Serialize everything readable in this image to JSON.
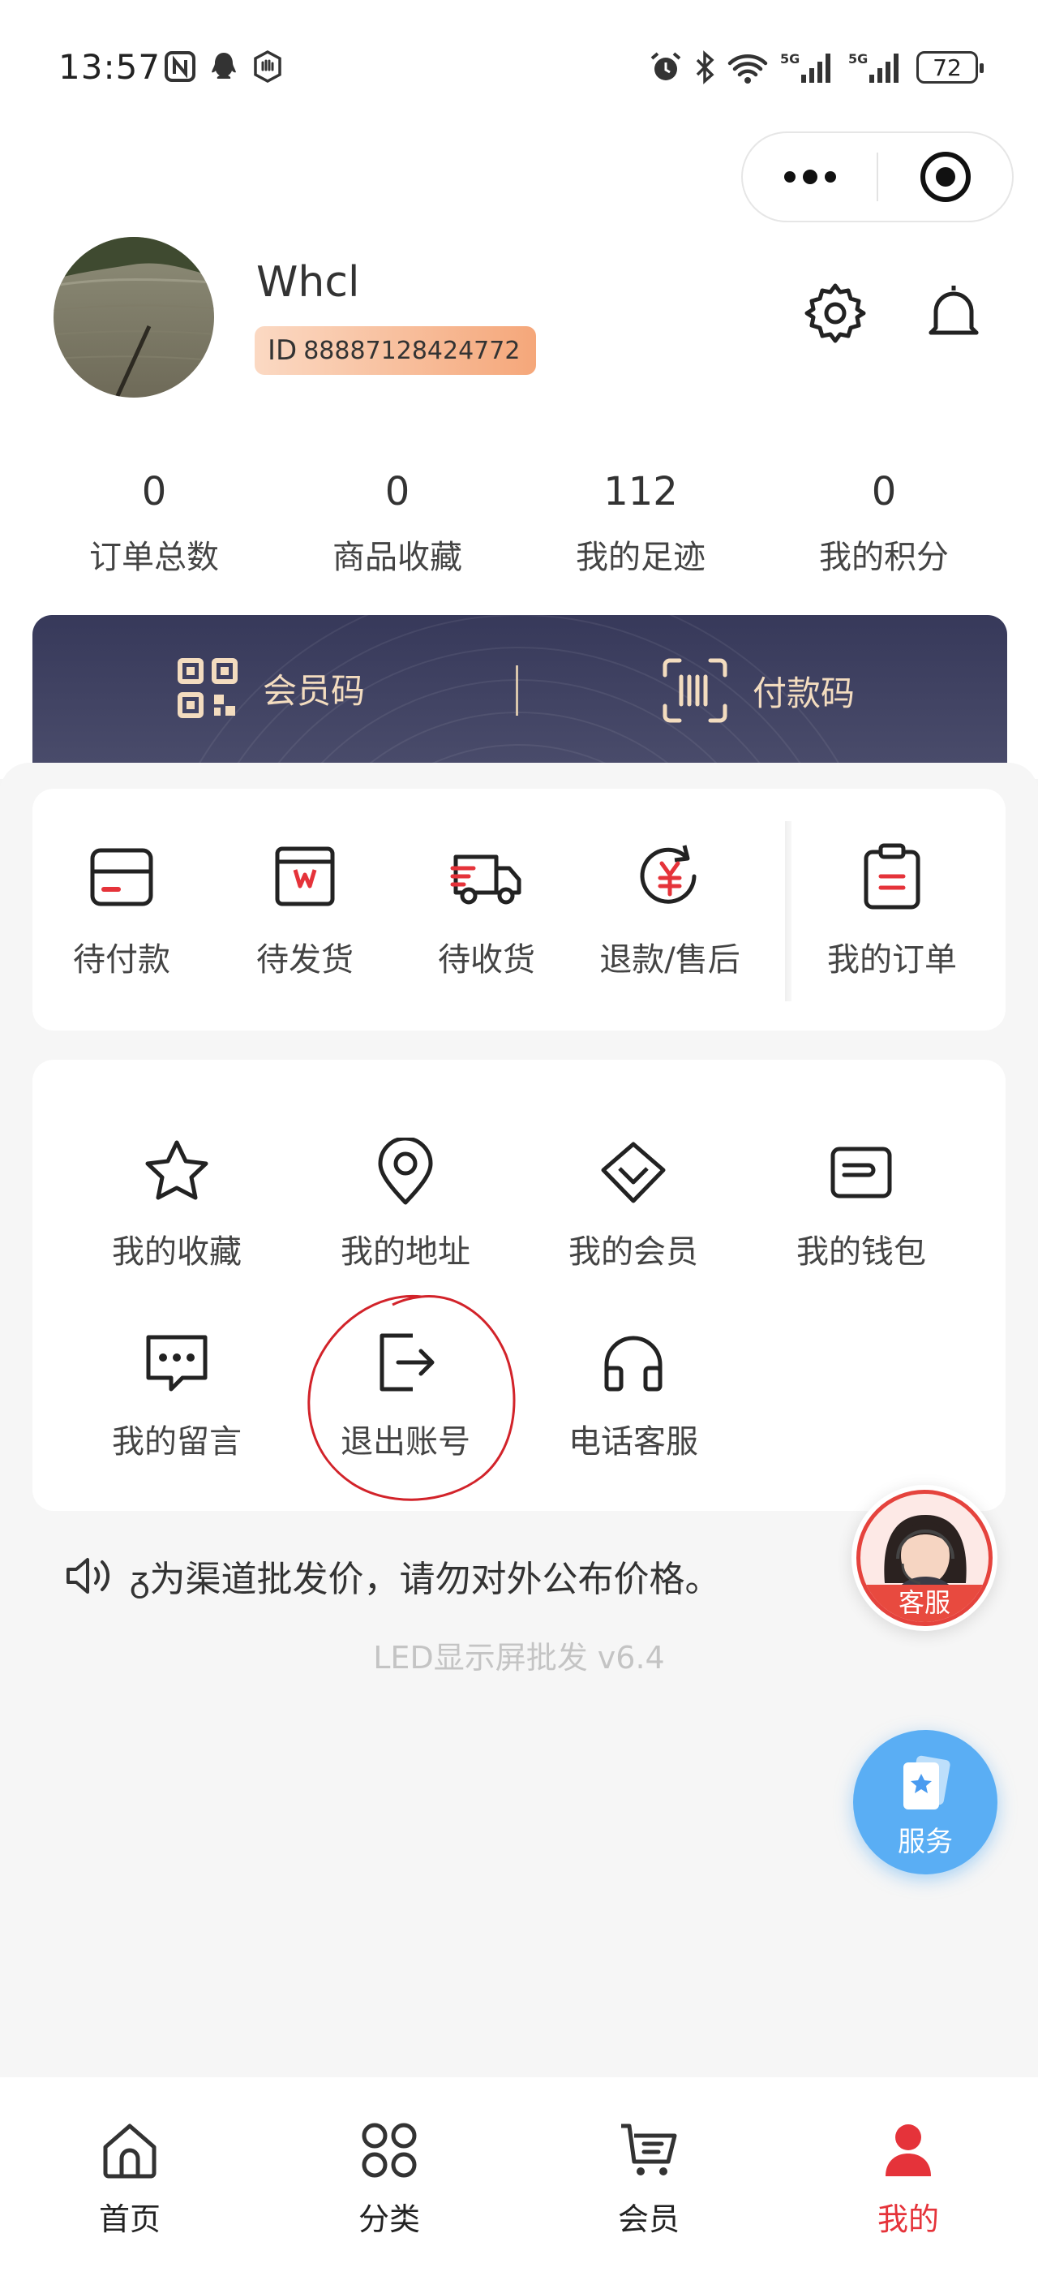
{
  "status_bar": {
    "time": "13:57",
    "battery": "72",
    "signal_1": "5G",
    "signal_2": "5G"
  },
  "profile": {
    "username": "Whcl",
    "id_label": "ID",
    "id_value": "88887128424772"
  },
  "stats": [
    {
      "value": "0",
      "label": "订单总数"
    },
    {
      "value": "0",
      "label": "商品收藏"
    },
    {
      "value": "112",
      "label": "我的足迹"
    },
    {
      "value": "0",
      "label": "我的积分"
    }
  ],
  "member_card": {
    "member_code": "会员码",
    "pay_code": "付款码"
  },
  "orders": [
    {
      "label": "待付款",
      "icon": "wallet-card-icon"
    },
    {
      "label": "待发货",
      "icon": "package-box-icon"
    },
    {
      "label": "待收货",
      "icon": "truck-icon"
    },
    {
      "label": "退款/售后",
      "icon": "refund-yuan-icon"
    },
    {
      "label": "我的订单",
      "icon": "clipboard-icon"
    }
  ],
  "services": [
    {
      "label": "我的收藏",
      "icon": "star-icon"
    },
    {
      "label": "我的地址",
      "icon": "location-pin-icon"
    },
    {
      "label": "我的会员",
      "icon": "diamond-icon"
    },
    {
      "label": "我的钱包",
      "icon": "wallet-icon"
    },
    {
      "label": "我的留言",
      "icon": "message-icon"
    },
    {
      "label": "退出账号",
      "icon": "logout-icon"
    },
    {
      "label": "电话客服",
      "icon": "headset-icon"
    }
  ],
  "notice": {
    "text": "ᵹ为渠道批发价，请勿对外公布价格。"
  },
  "version": "LED显示屏批发 v6.4",
  "floating": {
    "customer_service": "客服",
    "service": "服务"
  },
  "bottom_nav": [
    {
      "label": "首页",
      "icon": "home-icon"
    },
    {
      "label": "分类",
      "icon": "grid-icon"
    },
    {
      "label": "会员",
      "icon": "cart-icon"
    },
    {
      "label": "我的",
      "icon": "user-icon",
      "active": true
    }
  ],
  "colors": {
    "accent_red": "#e5333a",
    "member_card_bg": "#3a3c5c",
    "member_card_text": "#f3dcbf",
    "service_blue": "#5aaef4"
  }
}
